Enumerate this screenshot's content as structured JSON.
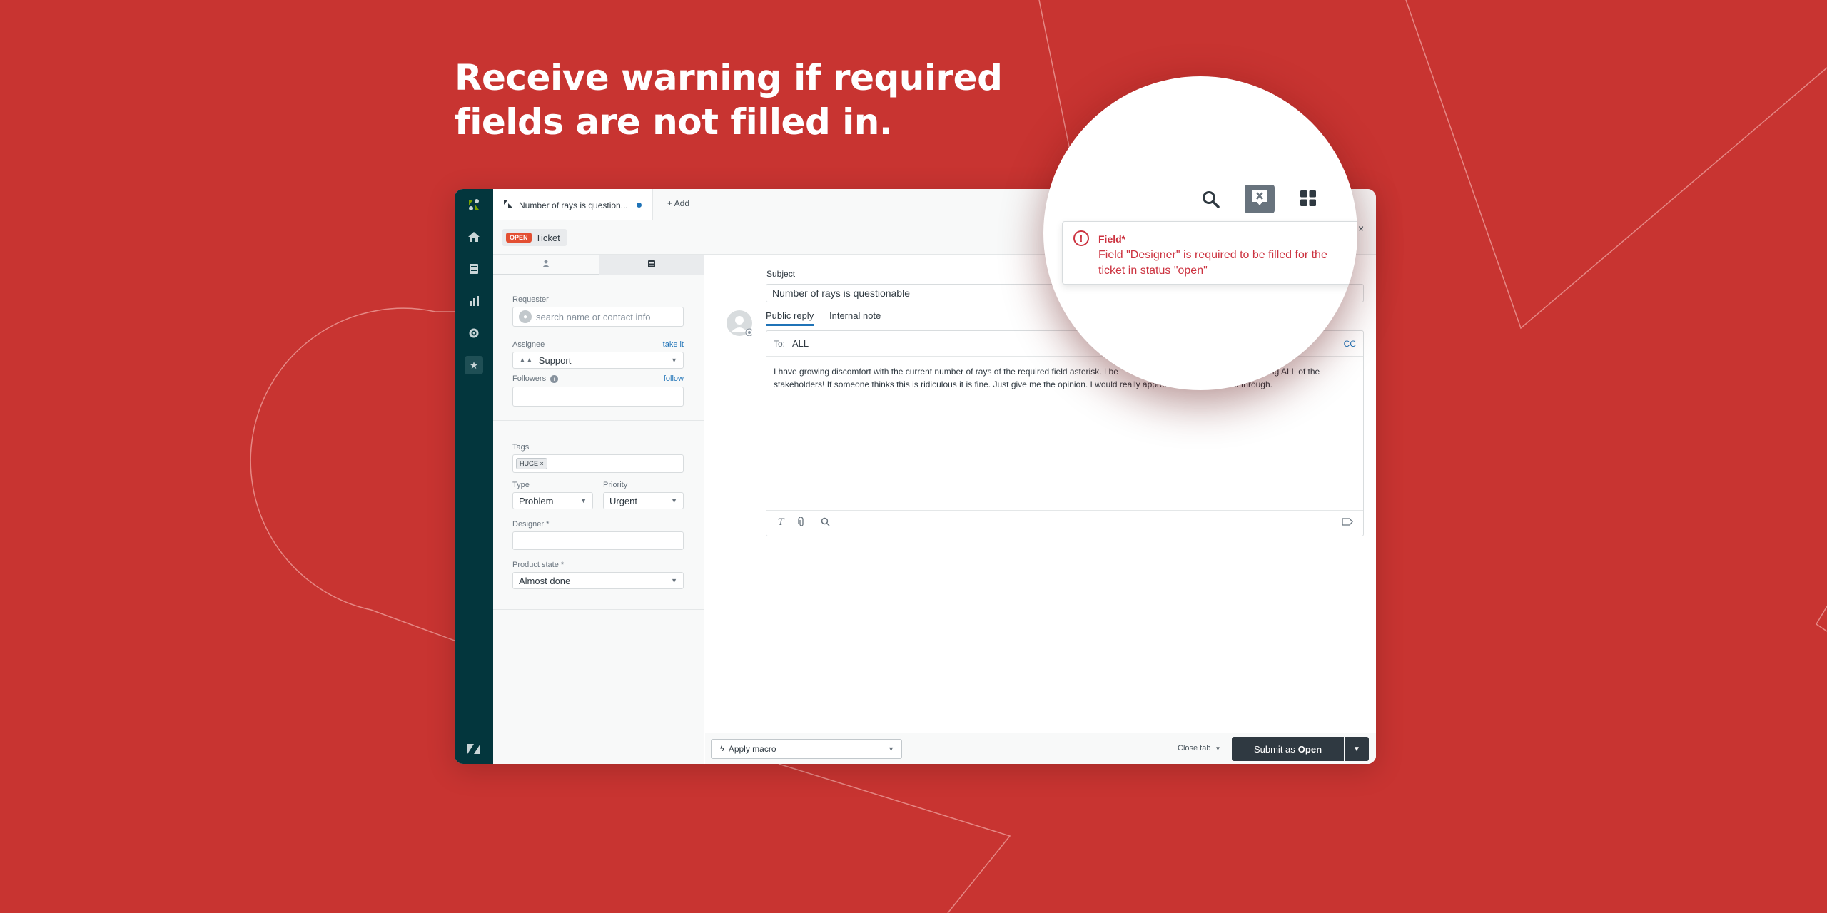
{
  "headline": {
    "line1": "Receive warning if required",
    "line2": "fields are not filled in."
  },
  "colors": {
    "background": "#c83431",
    "rail": "#03363d",
    "accent": "#1f73b7",
    "danger": "#cc3340"
  },
  "rail": {
    "icons": [
      "zendesk-logo-icon",
      "home-icon",
      "views-icon",
      "reporting-icon",
      "admin-gear-icon",
      "app-star-icon",
      "zendesk-z-icon"
    ]
  },
  "tabbar": {
    "ticket_tab": "Number of rays is question...",
    "add_label": "+ Add"
  },
  "subbar": {
    "status_badge": "OPEN",
    "ticket_label": "Ticket"
  },
  "fields": {
    "requester_label": "Requester",
    "requester_placeholder": "search name or contact info",
    "assignee_label": "Assignee",
    "take_it": "take it",
    "assignee_value": "Support",
    "followers_label": "Followers",
    "follow": "follow",
    "tags_label": "Tags",
    "tag_value": "HUGE ×",
    "type_label": "Type",
    "type_value": "Problem",
    "priority_label": "Priority",
    "priority_value": "Urgent",
    "designer_label": "Designer *",
    "product_state_label": "Product state *",
    "product_state_value": "Almost done"
  },
  "conversation": {
    "subject_label": "Subject",
    "subject_value": "Number of rays is questionable",
    "public_reply": "Public reply",
    "internal_note": "Internal note",
    "to_label": "To:",
    "to_value": "ALL",
    "cc": "CC",
    "body_line1": "I have growing discomfort with the current number of rays of the required field asterisk. I be",
    "body_line1_end": "ssed among ALL of the",
    "body_line2": "stakeholders! If someone thinks this is ridiculous it is fine. Just give me the opinion. I would really appreci",
    "body_line2_end": "commitment through."
  },
  "footer": {
    "apply_macro": "Apply macro",
    "close_tab": "Close tab",
    "submit_prefix": "Submit as",
    "submit_status": "Open"
  },
  "alert": {
    "title": "Field*",
    "message": "Field \"Designer\" is required to be filled for the ticket in status \"open\"",
    "close": "×"
  }
}
